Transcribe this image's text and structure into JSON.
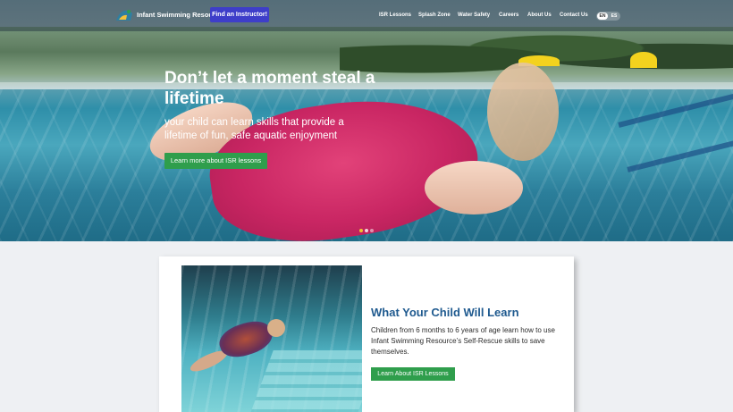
{
  "header": {
    "brand": "Infant Swimming Resource",
    "cta_label": "Find an Instructor!",
    "nav_items": [
      "ISR Lessons",
      "Splash Zone",
      "Water Safety",
      "Careers",
      "About Us",
      "Contact Us"
    ],
    "language": {
      "selected": "EN",
      "other": "ES"
    }
  },
  "hero": {
    "title": "Don’t let a moment steal a lifetime",
    "subtitle": "your child can learn skills that provide a lifetime of fun, safe aquatic enjoyment",
    "button_label": "Learn more about ISR lessons",
    "slides": 3,
    "active_slide": 1
  },
  "feature": {
    "title": "What Your Child Will Learn",
    "text": "Children from 6 months to 6 years of age learn how to use Infant Swimming Resource’s Self-Rescue skills to save themselves.",
    "button_label": "Learn About ISR Lessons"
  },
  "colors": {
    "accent_button": "#3e3ec9",
    "cta_green": "#2f9e4c",
    "heading_blue": "#1f5a8f"
  }
}
